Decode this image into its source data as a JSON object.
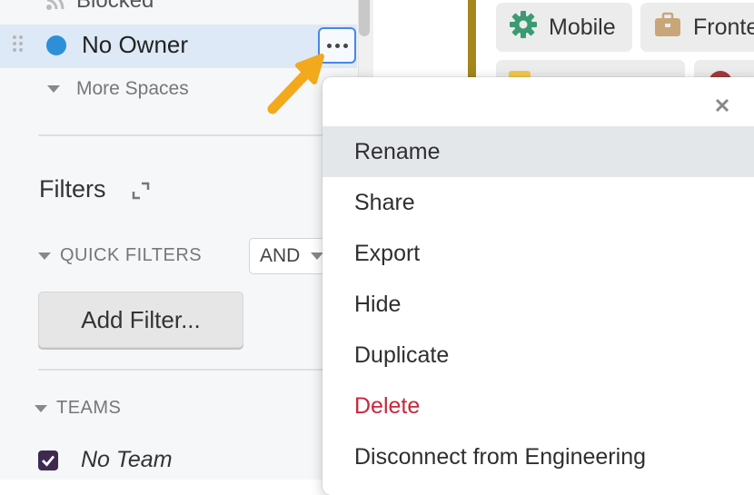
{
  "sidebar": {
    "blocked_label": "Blocked",
    "selected_space": {
      "label": "No Owner",
      "dot_color": "#2d8fd8"
    },
    "more_spaces_label": "More Spaces",
    "filters_title": "Filters",
    "quick_filters_label": "QUICK FILTERS",
    "combinator_value": "AND",
    "add_filter_label": "Add Filter...",
    "teams_label": "TEAMS",
    "team_items": [
      {
        "label": "No Team",
        "checked": true
      }
    ]
  },
  "content": {
    "chips": [
      {
        "label": "Mobile",
        "icon": "gear-icon",
        "icon_color": "#3c9a72"
      },
      {
        "label": "Fronte",
        "icon": "briefcase-icon",
        "icon_color": "#c8a67a"
      }
    ]
  },
  "context_menu": {
    "items": [
      {
        "label": "Rename",
        "active": true
      },
      {
        "label": "Share"
      },
      {
        "label": "Export"
      },
      {
        "label": "Hide"
      },
      {
        "label": "Duplicate"
      },
      {
        "label": "Delete",
        "danger": true
      },
      {
        "label": "Disconnect from Engineering"
      }
    ]
  },
  "colors": {
    "selection_bg": "#dde9f6",
    "focus_border": "#4a86e8",
    "danger": "#c8283a",
    "arrow": "#f2a91c",
    "checkbox": "#3f2a4f"
  }
}
